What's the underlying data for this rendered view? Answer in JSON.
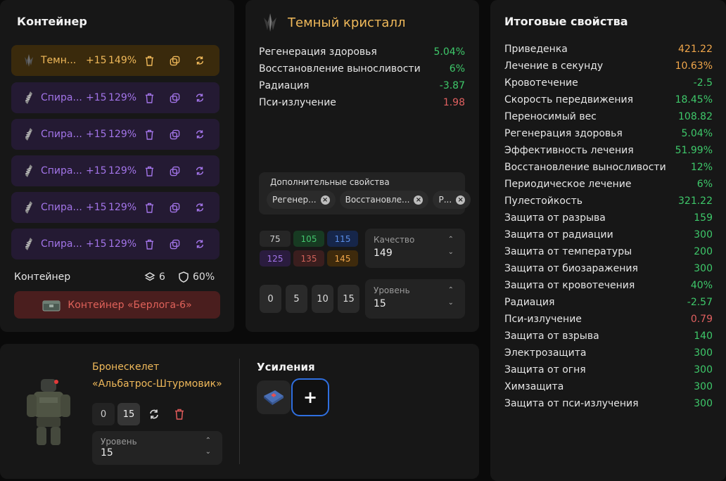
{
  "container_panel": {
    "title": "Контейнер",
    "rows": [
      {
        "name": "Темн...",
        "level": "+15",
        "percent": "149%",
        "style": "gold",
        "icon": "crystal-icon"
      },
      {
        "name": "Спира...",
        "level": "+15",
        "percent": "129%",
        "style": "purple",
        "icon": "spiral-icon"
      },
      {
        "name": "Спира...",
        "level": "+15",
        "percent": "129%",
        "style": "purple",
        "icon": "spiral-icon"
      },
      {
        "name": "Спира...",
        "level": "+15",
        "percent": "129%",
        "style": "purple",
        "icon": "spiral-icon"
      },
      {
        "name": "Спира...",
        "level": "+15",
        "percent": "129%",
        "style": "purple",
        "icon": "spiral-icon"
      },
      {
        "name": "Спира...",
        "level": "+15",
        "percent": "129%",
        "style": "purple",
        "icon": "spiral-icon"
      }
    ],
    "footer_label": "Контейнер",
    "slots": "6",
    "protection": "60%",
    "container_button": "Контейнер «Берлога-6»"
  },
  "crystal_panel": {
    "title": "Темный кристалл",
    "props": [
      {
        "name": "Регенерация здоровья",
        "value": "5.04%",
        "color": "green"
      },
      {
        "name": "Восстановление выносливости",
        "value": "6%",
        "color": "green"
      },
      {
        "name": "Радиация",
        "value": "-3.87",
        "color": "green"
      },
      {
        "name": "Пси-излучение",
        "value": "1.98",
        "color": "red"
      }
    ],
    "extra_title": "Дополнительные свойства",
    "chips": [
      "Регенер...",
      "Восстановле...",
      "Р..."
    ],
    "quality_cells": [
      "75",
      "105",
      "115",
      "125",
      "135",
      "145"
    ],
    "quality_label": "Качество",
    "quality_value": "149",
    "level_buttons": [
      "0",
      "5",
      "10",
      "15"
    ],
    "level_label": "Уровень",
    "level_value": "15"
  },
  "armor_panel": {
    "name_line1": "Бронескелет",
    "name_line2": "«Альбатрос-Штурмовик»",
    "btn_0": "0",
    "btn_15": "15",
    "level_label": "Уровень",
    "level_value": "15",
    "boosts_title": "Усиления",
    "add_label": "+"
  },
  "totals_panel": {
    "title": "Итоговые свойства",
    "rows": [
      {
        "name": "Приведенка",
        "value": "421.22",
        "color": "orange"
      },
      {
        "name": "Лечение в секунду",
        "value": "10.63%",
        "color": "orange"
      },
      {
        "name": "Кровотечение",
        "value": "-2.5",
        "color": "green"
      },
      {
        "name": "Скорость передвижения",
        "value": "18.45%",
        "color": "green"
      },
      {
        "name": "Переносимый вес",
        "value": "108.82",
        "color": "green"
      },
      {
        "name": "Регенерация здоровья",
        "value": "5.04%",
        "color": "green"
      },
      {
        "name": "Эффективность лечения",
        "value": "51.99%",
        "color": "green"
      },
      {
        "name": "Восстановление выносливости",
        "value": "12%",
        "color": "green"
      },
      {
        "name": "Периодическое лечение",
        "value": "6%",
        "color": "green"
      },
      {
        "name": "Пулестойкость",
        "value": "321.22",
        "color": "green"
      },
      {
        "name": "Защита от разрыва",
        "value": "159",
        "color": "green"
      },
      {
        "name": "Защита от радиации",
        "value": "300",
        "color": "green"
      },
      {
        "name": "Защита от температуры",
        "value": "200",
        "color": "green"
      },
      {
        "name": "Защита от биозаражения",
        "value": "300",
        "color": "green"
      },
      {
        "name": "Защита от кровотечения",
        "value": "40%",
        "color": "green"
      },
      {
        "name": "Радиация",
        "value": "-2.57",
        "color": "green"
      },
      {
        "name": "Пси-излучение",
        "value": "0.79",
        "color": "red"
      },
      {
        "name": "Защита от взрыва",
        "value": "140",
        "color": "green"
      },
      {
        "name": "Электрозащита",
        "value": "300",
        "color": "green"
      },
      {
        "name": "Защита от огня",
        "value": "300",
        "color": "green"
      },
      {
        "name": "Химзащита",
        "value": "300",
        "color": "green"
      },
      {
        "name": "Защита от пси-излучения",
        "value": "300",
        "color": "green"
      }
    ]
  }
}
